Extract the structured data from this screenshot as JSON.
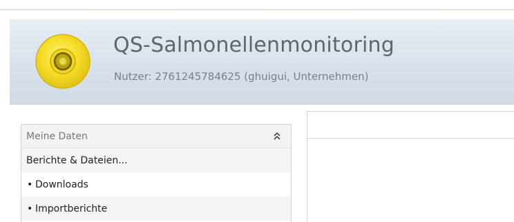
{
  "header": {
    "app_title": "QS-Salmonellenmonitoring",
    "user_info": "Nutzer: 2761245784625 (ghuigui, Unternehmen)",
    "logo_icon": "yellow-ear-tag-icon",
    "colors": {
      "header_bg": "#dbe3eb",
      "title": "#5c6670",
      "logo_yellow": "#f5dd28"
    }
  },
  "sidebar": {
    "header_label": "Meine Daten",
    "collapse_icon": "double-chevron-up-icon",
    "section_title": "Berichte & Dateien...",
    "items": [
      {
        "bullet": "•",
        "label": "Downloads"
      },
      {
        "bullet": "•",
        "label": "Importberichte"
      }
    ]
  }
}
